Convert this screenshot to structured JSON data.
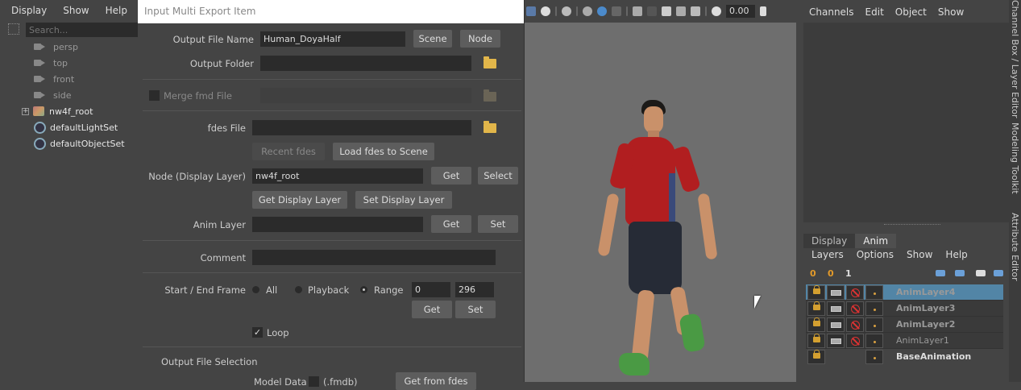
{
  "outliner": {
    "menu": [
      "Display",
      "Show",
      "Help"
    ],
    "search_placeholder": "Search...",
    "items": [
      {
        "label": "persp"
      },
      {
        "label": "top"
      },
      {
        "label": "front"
      },
      {
        "label": "side"
      },
      {
        "label": "nw4f_root"
      },
      {
        "label": "defaultLightSet"
      },
      {
        "label": "defaultObjectSet"
      }
    ]
  },
  "dialog": {
    "title": "Input Multi Export Item",
    "output_file_name_label": "Output File Name",
    "output_file_name_value": "Human_DoyaHalf",
    "scene_button": "Scene",
    "node_button": "Node",
    "output_folder_label": "Output Folder",
    "output_folder_value": "",
    "merge_fmd_label": "Merge fmd File",
    "fdes_file_label": "fdes File",
    "fdes_file_value": "",
    "recent_fdes_button": "Recent fdes",
    "load_fdes_button": "Load fdes to Scene",
    "node_display_layer_label": "Node (Display Layer)",
    "node_display_layer_value": "nw4f_root",
    "get_button": "Get",
    "select_button": "Select",
    "get_display_layer_button": "Get Display Layer",
    "set_display_layer_button": "Set Display Layer",
    "anim_layer_label": "Anim Layer",
    "anim_layer_value": "",
    "anim_get_button": "Get",
    "anim_set_button": "Set",
    "comment_label": "Comment",
    "comment_value": "",
    "start_end_label": "Start / End Frame",
    "radio_all": "All",
    "radio_playback": "Playback",
    "radio_range": "Range",
    "start_frame": "0",
    "end_frame": "296",
    "frame_get_button": "Get",
    "frame_set_button": "Set",
    "loop_label": "Loop",
    "loop_checked": true,
    "output_selection_label": "Output File Selection",
    "model_data_label": "Model Data",
    "model_data_ext": "(.fmdb)",
    "get_from_fdes_button": "Get from fdes"
  },
  "viewport": {
    "value_field": "0.00"
  },
  "channelbox": {
    "menu": [
      "Channels",
      "Edit",
      "Object",
      "Show"
    ],
    "tabs": [
      "Display",
      "Anim"
    ],
    "active_tab": "Anim",
    "layer_menu": [
      "Layers",
      "Options",
      "Show",
      "Help"
    ],
    "layers": [
      {
        "name": "AnimLayer4",
        "selected": true
      },
      {
        "name": "AnimLayer3",
        "selected": false
      },
      {
        "name": "AnimLayer2",
        "selected": false
      },
      {
        "name": "AnimLayer1",
        "selected": false
      },
      {
        "name": "BaseAnimation",
        "selected": false
      }
    ]
  },
  "sidestrip": {
    "labels": [
      "Channel Box / Layer Editor",
      "Modeling Toolkit",
      "Attribute Editor"
    ]
  },
  "colors": {
    "panel_bg": "#444444",
    "field_bg": "#2b2b2b",
    "viewport_bg": "#6e6e6e",
    "selected_layer": "#5285a6",
    "folder": "#e2b64a"
  }
}
